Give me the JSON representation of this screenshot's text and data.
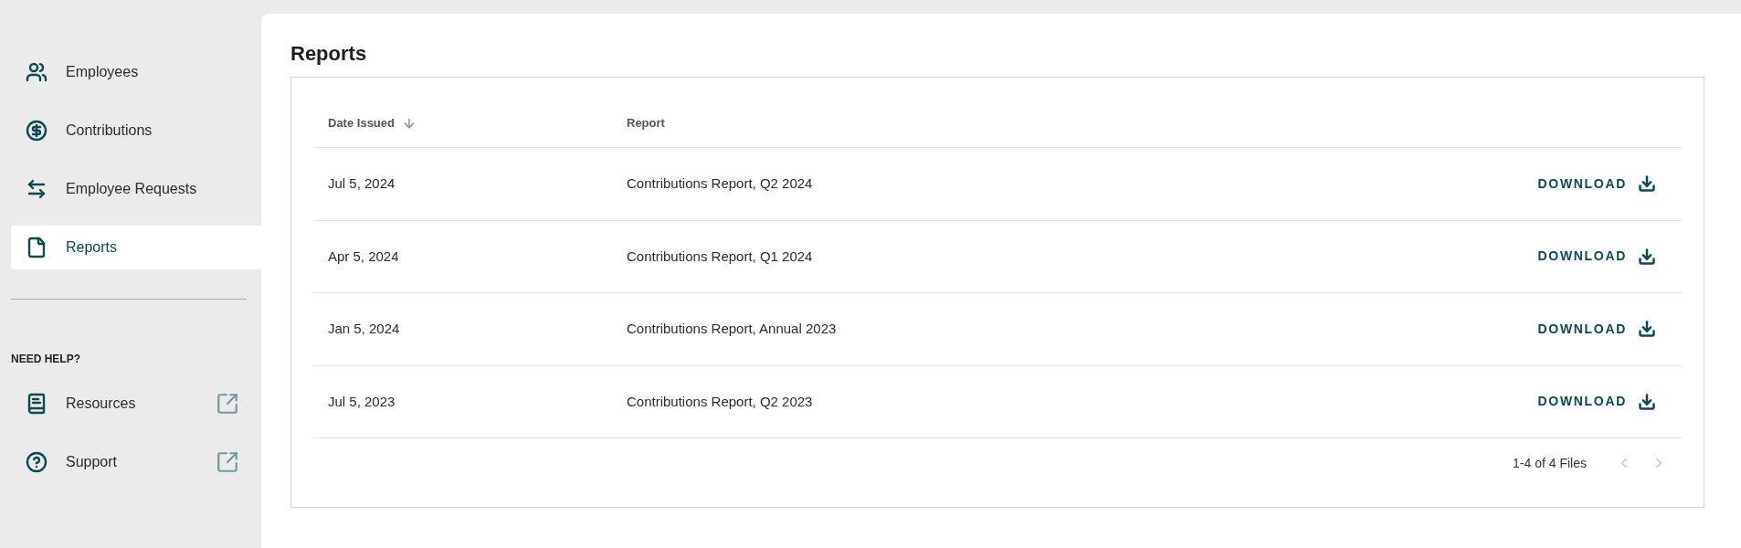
{
  "sidebar": {
    "items": [
      {
        "label": "Employees",
        "selected": false
      },
      {
        "label": "Contributions",
        "selected": false
      },
      {
        "label": "Employee Requests",
        "selected": false
      },
      {
        "label": "Reports",
        "selected": true
      }
    ],
    "help_heading": "NEED HELP?",
    "help_items": [
      {
        "label": "Resources",
        "external": true
      },
      {
        "label": "Support",
        "external": true
      }
    ]
  },
  "page": {
    "title": "Reports"
  },
  "table": {
    "columns": [
      {
        "label": "Date Issued",
        "sorted": true
      },
      {
        "label": "Report",
        "sorted": false
      }
    ],
    "rows": [
      {
        "date": "Jul 5, 2024",
        "report": "Contributions Report, Q2 2024",
        "action": "DOWNLOAD"
      },
      {
        "date": "Apr 5, 2024",
        "report": "Contributions Report, Q1 2024",
        "action": "DOWNLOAD"
      },
      {
        "date": "Jan 5, 2024",
        "report": "Contributions Report, Annual 2023",
        "action": "DOWNLOAD"
      },
      {
        "date": "Jul 5, 2023",
        "report": "Contributions Report, Q2 2023",
        "action": "DOWNLOAD"
      }
    ]
  },
  "pagination": {
    "summary": "1-4 of 4 Files",
    "prev_disabled": true,
    "next_disabled": true
  }
}
